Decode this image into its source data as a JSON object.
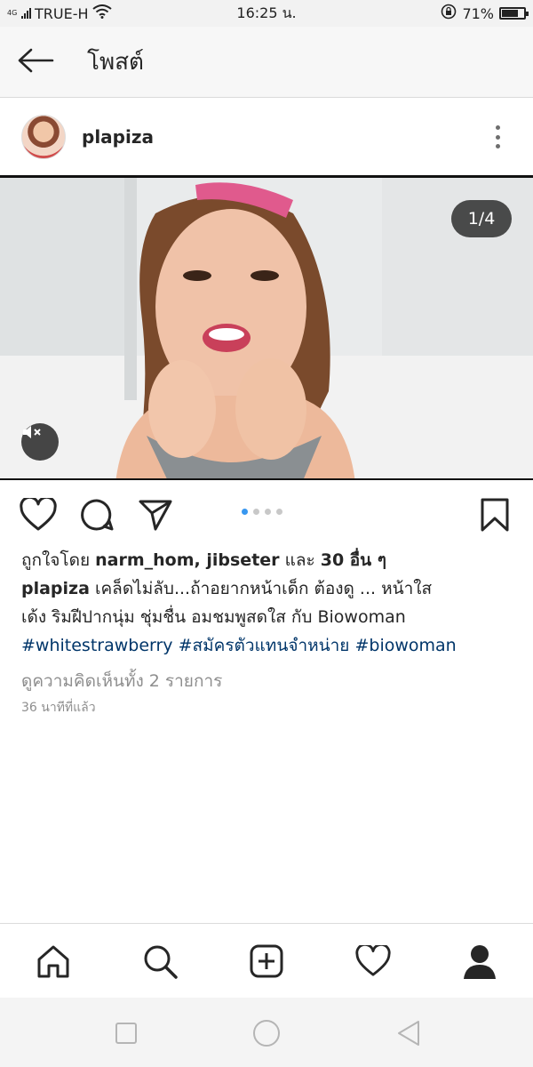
{
  "status_bar": {
    "network_type": "4G",
    "carrier": "TRUE-H",
    "time": "16:25 น.",
    "battery": "71%",
    "battery_level": 0.71
  },
  "header": {
    "title": "โพสต์",
    "back_icon": "arrow-left-icon"
  },
  "post": {
    "username": "plapiza",
    "media_counter": "1/4",
    "carousel_total": 4,
    "carousel_active": 0,
    "likes": {
      "prefix": "ถูกใจโดย ",
      "users": "narm_hom, jibseter",
      "connector": " และ ",
      "others": "30 อื่น ๆ"
    },
    "caption": {
      "author": "plapiza",
      "line1": " เคล็ดไม่ลับ...ถ้าอยากหน้าเด็ก ต้องดู ... หน้าใส",
      "line2": "เด้ง  ริมฝีปากนุ่ม ชุ่มชื่น อมชมพูสดใส กับ Biowoman",
      "hashtags": [
        "#whitestrawberry",
        "#สมัครตัวแทนจำหน่าย",
        "#biowoman"
      ]
    },
    "view_comments": "ดูความคิดเห็นทั้ง 2 รายการ",
    "time_ago": "36 นาทีที่แล้ว"
  },
  "colors": {
    "link": "#003569",
    "muted": "#8e8e8e",
    "dot_active": "#3897f0"
  }
}
